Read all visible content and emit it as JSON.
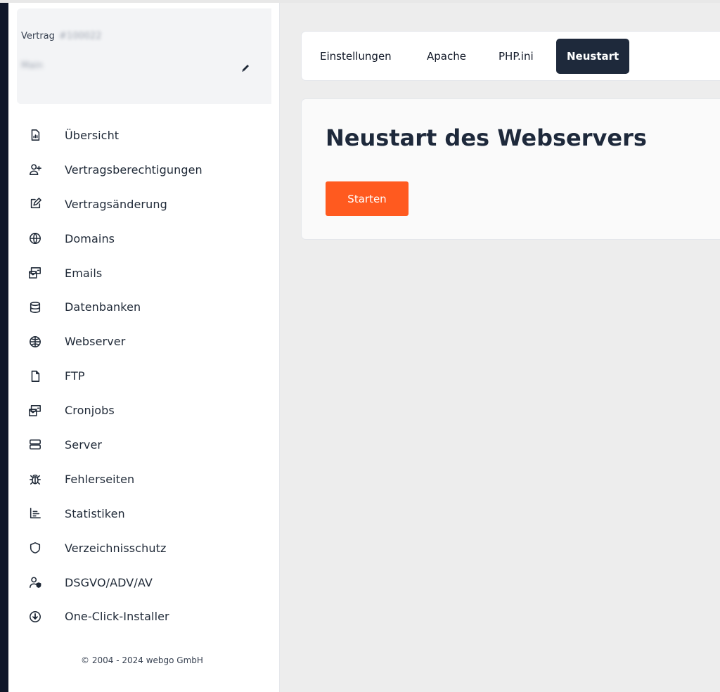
{
  "contract": {
    "label": "Vertrag",
    "id": "#100022",
    "name": "Main"
  },
  "sidebar": {
    "items": [
      {
        "label": "Übersicht",
        "icon": "document-chart-icon"
      },
      {
        "label": "Vertragsberechtigungen",
        "icon": "user-plus-icon"
      },
      {
        "label": "Vertragsänderung",
        "icon": "pencil-square-icon"
      },
      {
        "label": "Domains",
        "icon": "globe-icon"
      },
      {
        "label": "Emails",
        "icon": "mail-inbox-icon"
      },
      {
        "label": "Datenbanken",
        "icon": "database-icon"
      },
      {
        "label": "Webserver",
        "icon": "globe-network-icon"
      },
      {
        "label": "FTP",
        "icon": "file-icon"
      },
      {
        "label": "Cronjobs",
        "icon": "mail-inbox-icon"
      },
      {
        "label": "Server",
        "icon": "server-icon"
      },
      {
        "label": "Fehlerseiten",
        "icon": "bug-icon"
      },
      {
        "label": "Statistiken",
        "icon": "bar-chart-icon"
      },
      {
        "label": "Verzeichnisschutz",
        "icon": "shield-icon"
      },
      {
        "label": "DSGVO/ADV/AV",
        "icon": "user-shield-icon"
      },
      {
        "label": "One-Click-Installer",
        "icon": "download-circle-icon"
      }
    ]
  },
  "copyright": "© 2004 - 2024 webgo GmbH",
  "tabs": [
    {
      "label": "Einstellungen"
    },
    {
      "label": "Apache"
    },
    {
      "label": "PHP.ini"
    },
    {
      "label": "Neustart"
    }
  ],
  "card": {
    "title": "Neustart des Webservers",
    "button_label": "Starten"
  },
  "colors": {
    "accent": "#ff5a1f",
    "active_tab": "#1e293b",
    "main_bg": "#ededed"
  }
}
